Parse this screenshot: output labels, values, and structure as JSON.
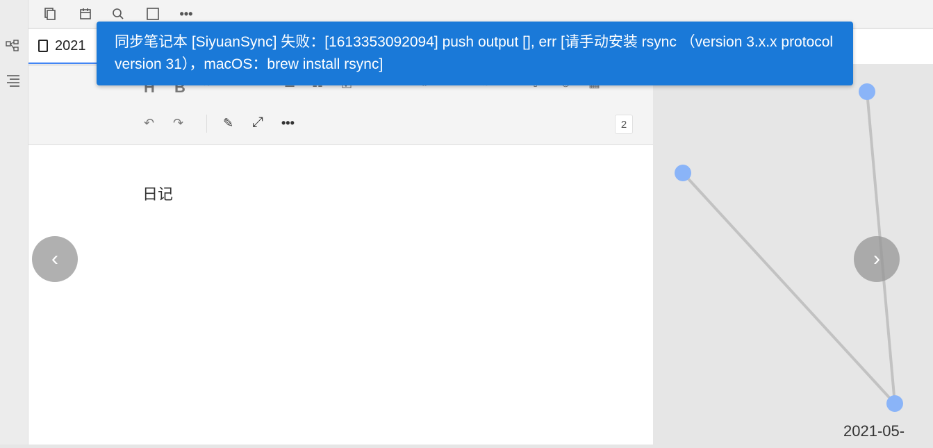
{
  "tab": {
    "title": "2021"
  },
  "toolbar_icons": [
    "crown-icon",
    "copy-icon",
    "calendar-icon",
    "search-icon",
    "square-icon",
    "more-icon"
  ],
  "editor": {
    "counter": "2",
    "content": "日记"
  },
  "toast": {
    "message": "同步笔记本 [SiyuanSync] 失败：[1613353092094] push output [], err [请手动安装 rsync （version 3.x.x protocol version 31），macOS：brew install rsync]"
  },
  "graph": {
    "date_label": "2021-05-"
  },
  "colors": {
    "toast_bg": "#1a79d8",
    "node": "#8ab4f8",
    "accent": "#4285f4"
  }
}
